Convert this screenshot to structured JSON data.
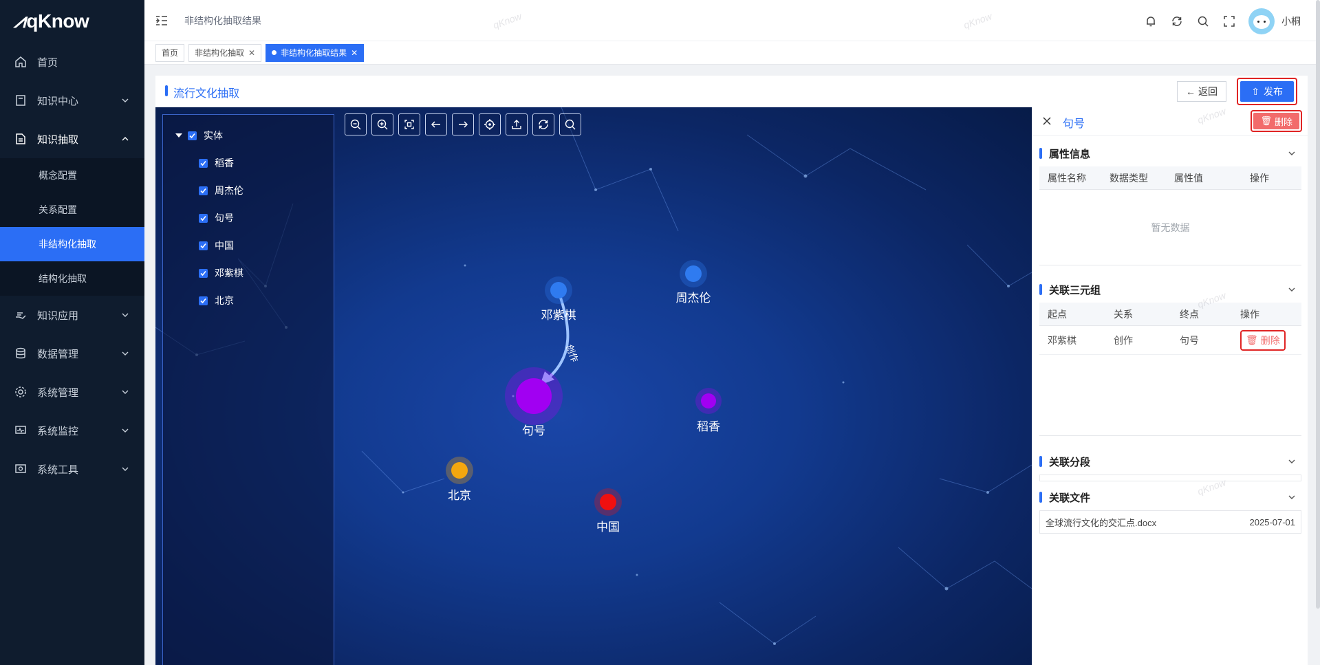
{
  "app": {
    "logo_text": "qKnow"
  },
  "sidebar": {
    "items": [
      {
        "label": "首页",
        "icon": "home-icon",
        "has_children": false
      },
      {
        "label": "知识中心",
        "icon": "book-icon",
        "has_children": true
      },
      {
        "label": "知识抽取",
        "icon": "document-icon",
        "has_children": true,
        "open": true,
        "children": [
          {
            "label": "概念配置",
            "active": false
          },
          {
            "label": "关系配置",
            "active": false
          },
          {
            "label": "非结构化抽取",
            "active": true
          },
          {
            "label": "结构化抽取",
            "active": false
          }
        ]
      },
      {
        "label": "知识应用",
        "icon": "hand-icon",
        "has_children": true
      },
      {
        "label": "数据管理",
        "icon": "database-icon",
        "has_children": true
      },
      {
        "label": "系统管理",
        "icon": "gear-icon",
        "has_children": true
      },
      {
        "label": "系统监控",
        "icon": "monitor-icon",
        "has_children": true
      },
      {
        "label": "系统工具",
        "icon": "tools-icon",
        "has_children": true
      }
    ]
  },
  "header": {
    "title": "非结构化抽取结果",
    "user_name": "小桐",
    "icons": [
      "bell-icon",
      "refresh-icon",
      "search-icon",
      "fullscreen-icon"
    ]
  },
  "tabs": [
    {
      "label": "首页",
      "closable": false,
      "active": false
    },
    {
      "label": "非结构化抽取",
      "closable": true,
      "active": false
    },
    {
      "label": "非结构化抽取结果",
      "closable": true,
      "active": true
    }
  ],
  "card": {
    "title": "流行文化抽取",
    "back_label": "返回",
    "publish_label": "发布"
  },
  "tree": {
    "root_label": "实体",
    "items": [
      "稻香",
      "周杰伦",
      "句号",
      "中国",
      "邓紫棋",
      "北京"
    ]
  },
  "toolbar": [
    "zoom-out-icon",
    "zoom-in-icon",
    "fit-icon",
    "arrow-left-icon",
    "arrow-right-icon",
    "target-icon",
    "export-icon",
    "refresh-icon",
    "search-icon"
  ],
  "graph": {
    "nodes": [
      {
        "id": "dzq",
        "label": "邓紫棋",
        "color": "#2f7bf0"
      },
      {
        "id": "zjl",
        "label": "周杰伦",
        "color": "#2f7bf0"
      },
      {
        "id": "jh",
        "label": "句号",
        "color": "#a100f2"
      },
      {
        "id": "dx",
        "label": "稻香",
        "color": "#a100f2"
      },
      {
        "id": "bj",
        "label": "北京",
        "color": "#f5a70e"
      },
      {
        "id": "zg",
        "label": "中国",
        "color": "#f01010"
      }
    ],
    "edges": [
      {
        "from": "dzq",
        "to": "jh",
        "label": "创作"
      }
    ]
  },
  "panel": {
    "title": "句号",
    "delete_label": "删除",
    "attr_section": {
      "title": "属性信息",
      "columns": [
        "属性名称",
        "数据类型",
        "属性值",
        "操作"
      ],
      "empty_text": "暂无数据"
    },
    "triple_section": {
      "title": "关联三元组",
      "columns": [
        "起点",
        "关系",
        "终点",
        "操作"
      ],
      "rows": [
        {
          "start": "邓紫棋",
          "relation": "创作",
          "end": "句号",
          "action": "删除"
        }
      ]
    },
    "segment_section": {
      "title": "关联分段"
    },
    "file_section": {
      "title": "关联文件",
      "files": [
        {
          "name": "全球流行文化的交汇点.docx",
          "date": "2025-07-01"
        }
      ]
    }
  },
  "watermark": "qKnow",
  "colors": {
    "primary": "#2b6ef5",
    "danger": "#e02424",
    "sidebar_bg": "#0f1c2e"
  }
}
